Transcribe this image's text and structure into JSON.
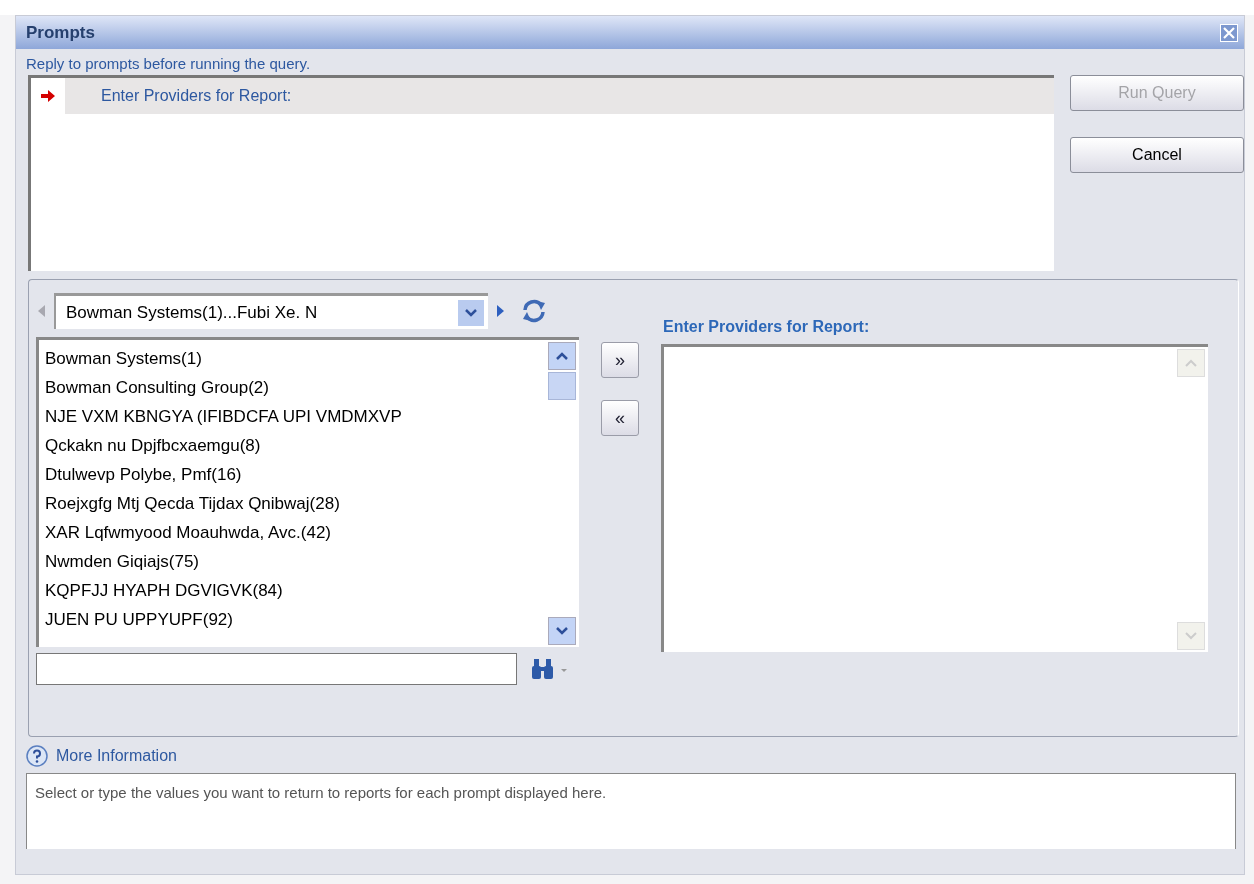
{
  "window": {
    "title": "Prompts"
  },
  "instruction": "Reply to prompts before running the query.",
  "prompts": [
    {
      "label": "Enter Providers for Report:",
      "selected": true
    }
  ],
  "buttons": [
    {
      "label": "Run Query",
      "disabled": true
    },
    {
      "label": "Cancel",
      "disabled": false
    }
  ],
  "value_picker": {
    "range_dropdown": "Bowman Systems(1)...Fubi Xe. N",
    "available_values": [
      "Bowman Systems(1)",
      "Bowman Consulting Group(2)",
      "NJE VXM KBNGYA (IFIBDCFA UPI VMDMXVP",
      "Qckakn nu Dpjfbcxaemgu(8)",
      "Dtulwevp Polybe, Pmf(16)",
      "Roejxgfg Mtj Qecda Tijdax Qnibwaj(28)",
      "XAR Lqfwmyood Moauhwda, Avc.(42)",
      "Nwmden Giqiajs(75)",
      "KQPFJJ HYAPH DGVIGVK(84)",
      "JUEN PU UPPYUPF(92)"
    ],
    "add_button": "»",
    "remove_button": "«",
    "selected_header": "Enter Providers for Report:"
  },
  "help": {
    "link": "More Information",
    "text": "Select or type the values you want to return to reports for each prompt displayed here."
  }
}
